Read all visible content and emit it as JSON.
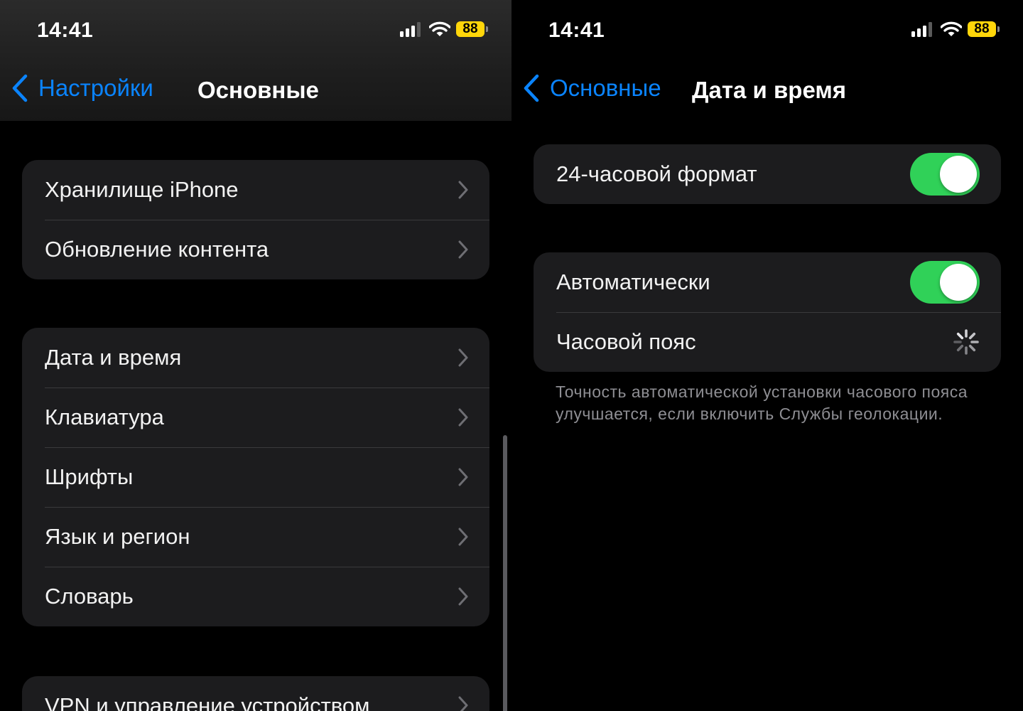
{
  "left": {
    "status": {
      "time": "14:41",
      "battery": "88"
    },
    "nav": {
      "back_label": "Настройки",
      "title": "Основные"
    },
    "group1": [
      "Хранилище iPhone",
      "Обновление контента"
    ],
    "group2": [
      "Дата и время",
      "Клавиатура",
      "Шрифты",
      "Язык и регион",
      "Словарь"
    ],
    "group3": [
      "VPN и управление устройством"
    ]
  },
  "right": {
    "status": {
      "time": "14:41",
      "battery": "88"
    },
    "nav": {
      "back_label": "Основные",
      "title": "Дата и время"
    },
    "format_24h": {
      "label": "24-часовой формат",
      "on": true
    },
    "auto": {
      "label": "Автоматически",
      "on": true
    },
    "timezone": {
      "label": "Часовой пояс"
    },
    "footnote": "Точность автоматической установки часового пояса улучшается, если включить Службы геолокации."
  },
  "colors": {
    "accent": "#0a84ff",
    "toggle_on": "#30d158",
    "battery": "#ffd60a",
    "cell_bg": "#1c1c1e"
  },
  "icons": [
    "chevron-left-icon",
    "chevron-right-icon",
    "cellular-signal-icon",
    "wifi-icon",
    "battery-icon",
    "loading-spinner-icon"
  ]
}
